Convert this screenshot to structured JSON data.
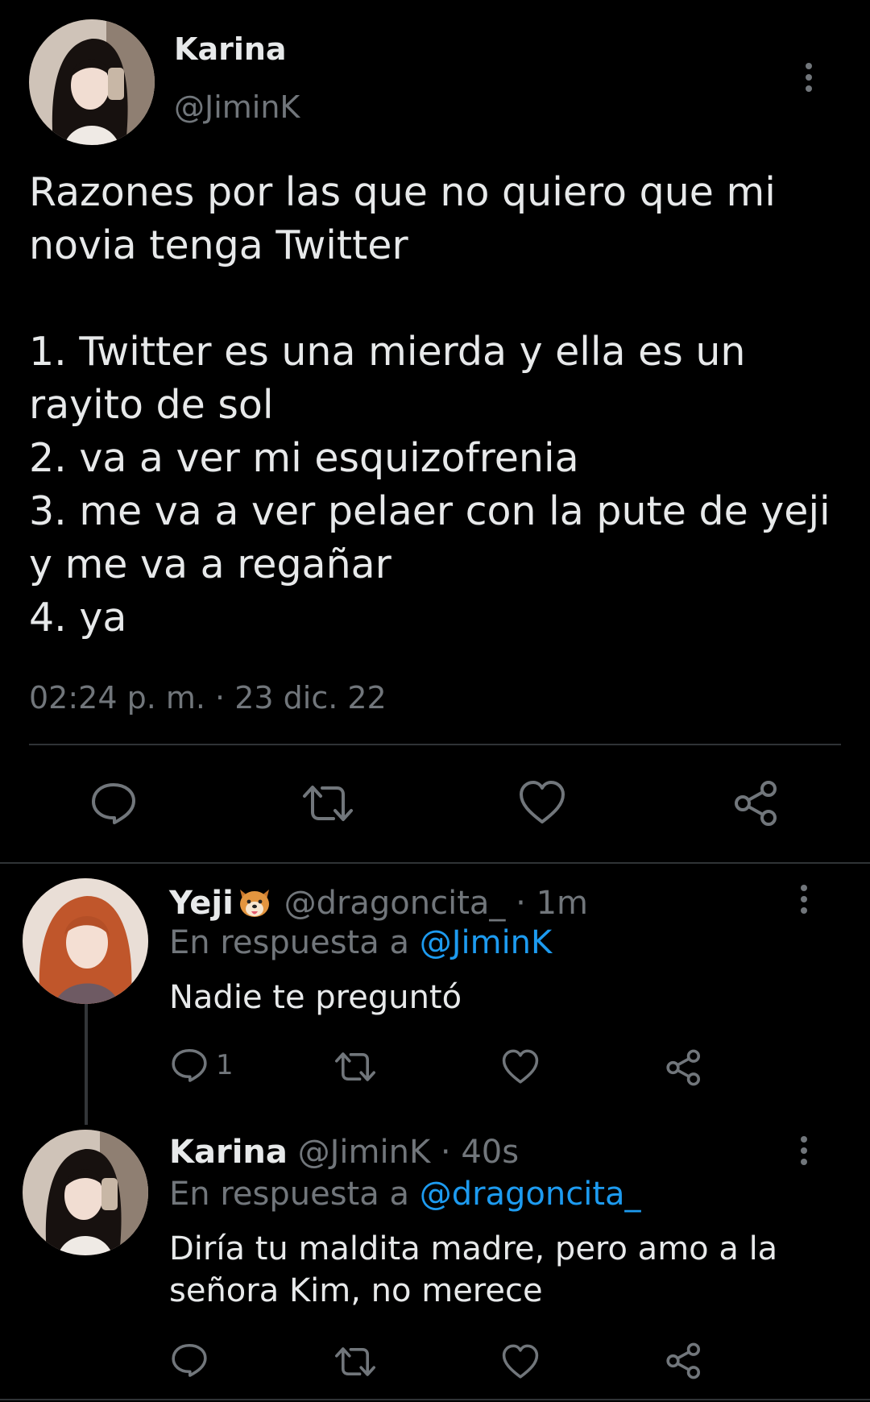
{
  "main_tweet": {
    "author_name": "Karina",
    "author_handle": "@JiminK",
    "text": "Razones por las que no quiero que mi novia tenga Twitter\n\n1. Twitter es una mierda y ella es un rayito de sol\n2. va a ver mi esquizofrenia\n3. me va a ver pelaer con la pute de yeji y me va a regañar\n4. ya",
    "timestamp": "02:24 p. m. · 23 dic. 22",
    "actions": [
      "reply-icon",
      "retweet-icon",
      "like-icon",
      "share-icon"
    ]
  },
  "replies": [
    {
      "author_name": "Yeji",
      "emoji": "dog-face-emoji",
      "author_handle": "@dragoncita_",
      "separator": "·",
      "time": "1m",
      "replying_prefix": "En respuesta a",
      "replying_to": "@JiminK",
      "text": "Nadie te preguntó",
      "reply_count": "1"
    },
    {
      "author_name": "Karina",
      "author_handle": "@JiminK",
      "separator": "·",
      "time": "40s",
      "replying_prefix": "En respuesta a",
      "replying_to": "@dragoncita_",
      "text": "Diría tu maldita madre, pero amo a la señora Kim, no merece",
      "reply_count": ""
    }
  ],
  "colors": {
    "background": "#000000",
    "text_primary": "#e7e9ea",
    "text_secondary": "#71767b",
    "link": "#1d9bf0",
    "divider": "#2f3336"
  }
}
